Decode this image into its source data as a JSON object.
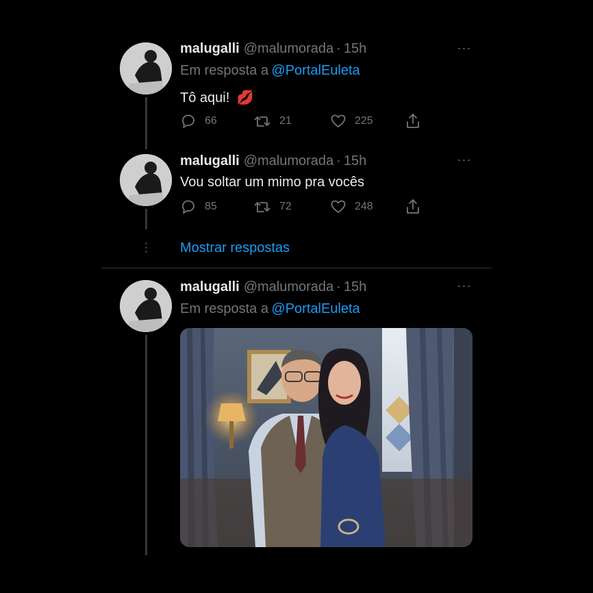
{
  "tweets": [
    {
      "display_name": "malugalli",
      "handle": "@malumorada",
      "separator": "·",
      "time": "15h",
      "reply_prefix": "Em resposta a",
      "reply_to": "@PortalEuleta",
      "text": "Tô aqui!",
      "emoji": "💋",
      "replies": "66",
      "retweets": "21",
      "likes": "225"
    },
    {
      "display_name": "malugalli",
      "handle": "@malumorada",
      "separator": "·",
      "time": "15h",
      "text": "Vou soltar um mimo pra vocês",
      "replies": "85",
      "retweets": "72",
      "likes": "248"
    },
    {
      "display_name": "malugalli",
      "handle": "@malumorada",
      "separator": "·",
      "time": "15h",
      "reply_prefix": "Em resposta a",
      "reply_to": "@PortalEuleta"
    }
  ],
  "show_replies_label": "Mostrar respostas",
  "more_glyph": "···",
  "icons": [
    "reply-icon",
    "retweet-icon",
    "like-icon",
    "share-icon",
    "more-icon"
  ],
  "colors": {
    "background": "#000000",
    "text": "#e7e9ea",
    "muted": "#71767b",
    "accent": "#1d9bf0",
    "emoji": "#e0245e"
  }
}
